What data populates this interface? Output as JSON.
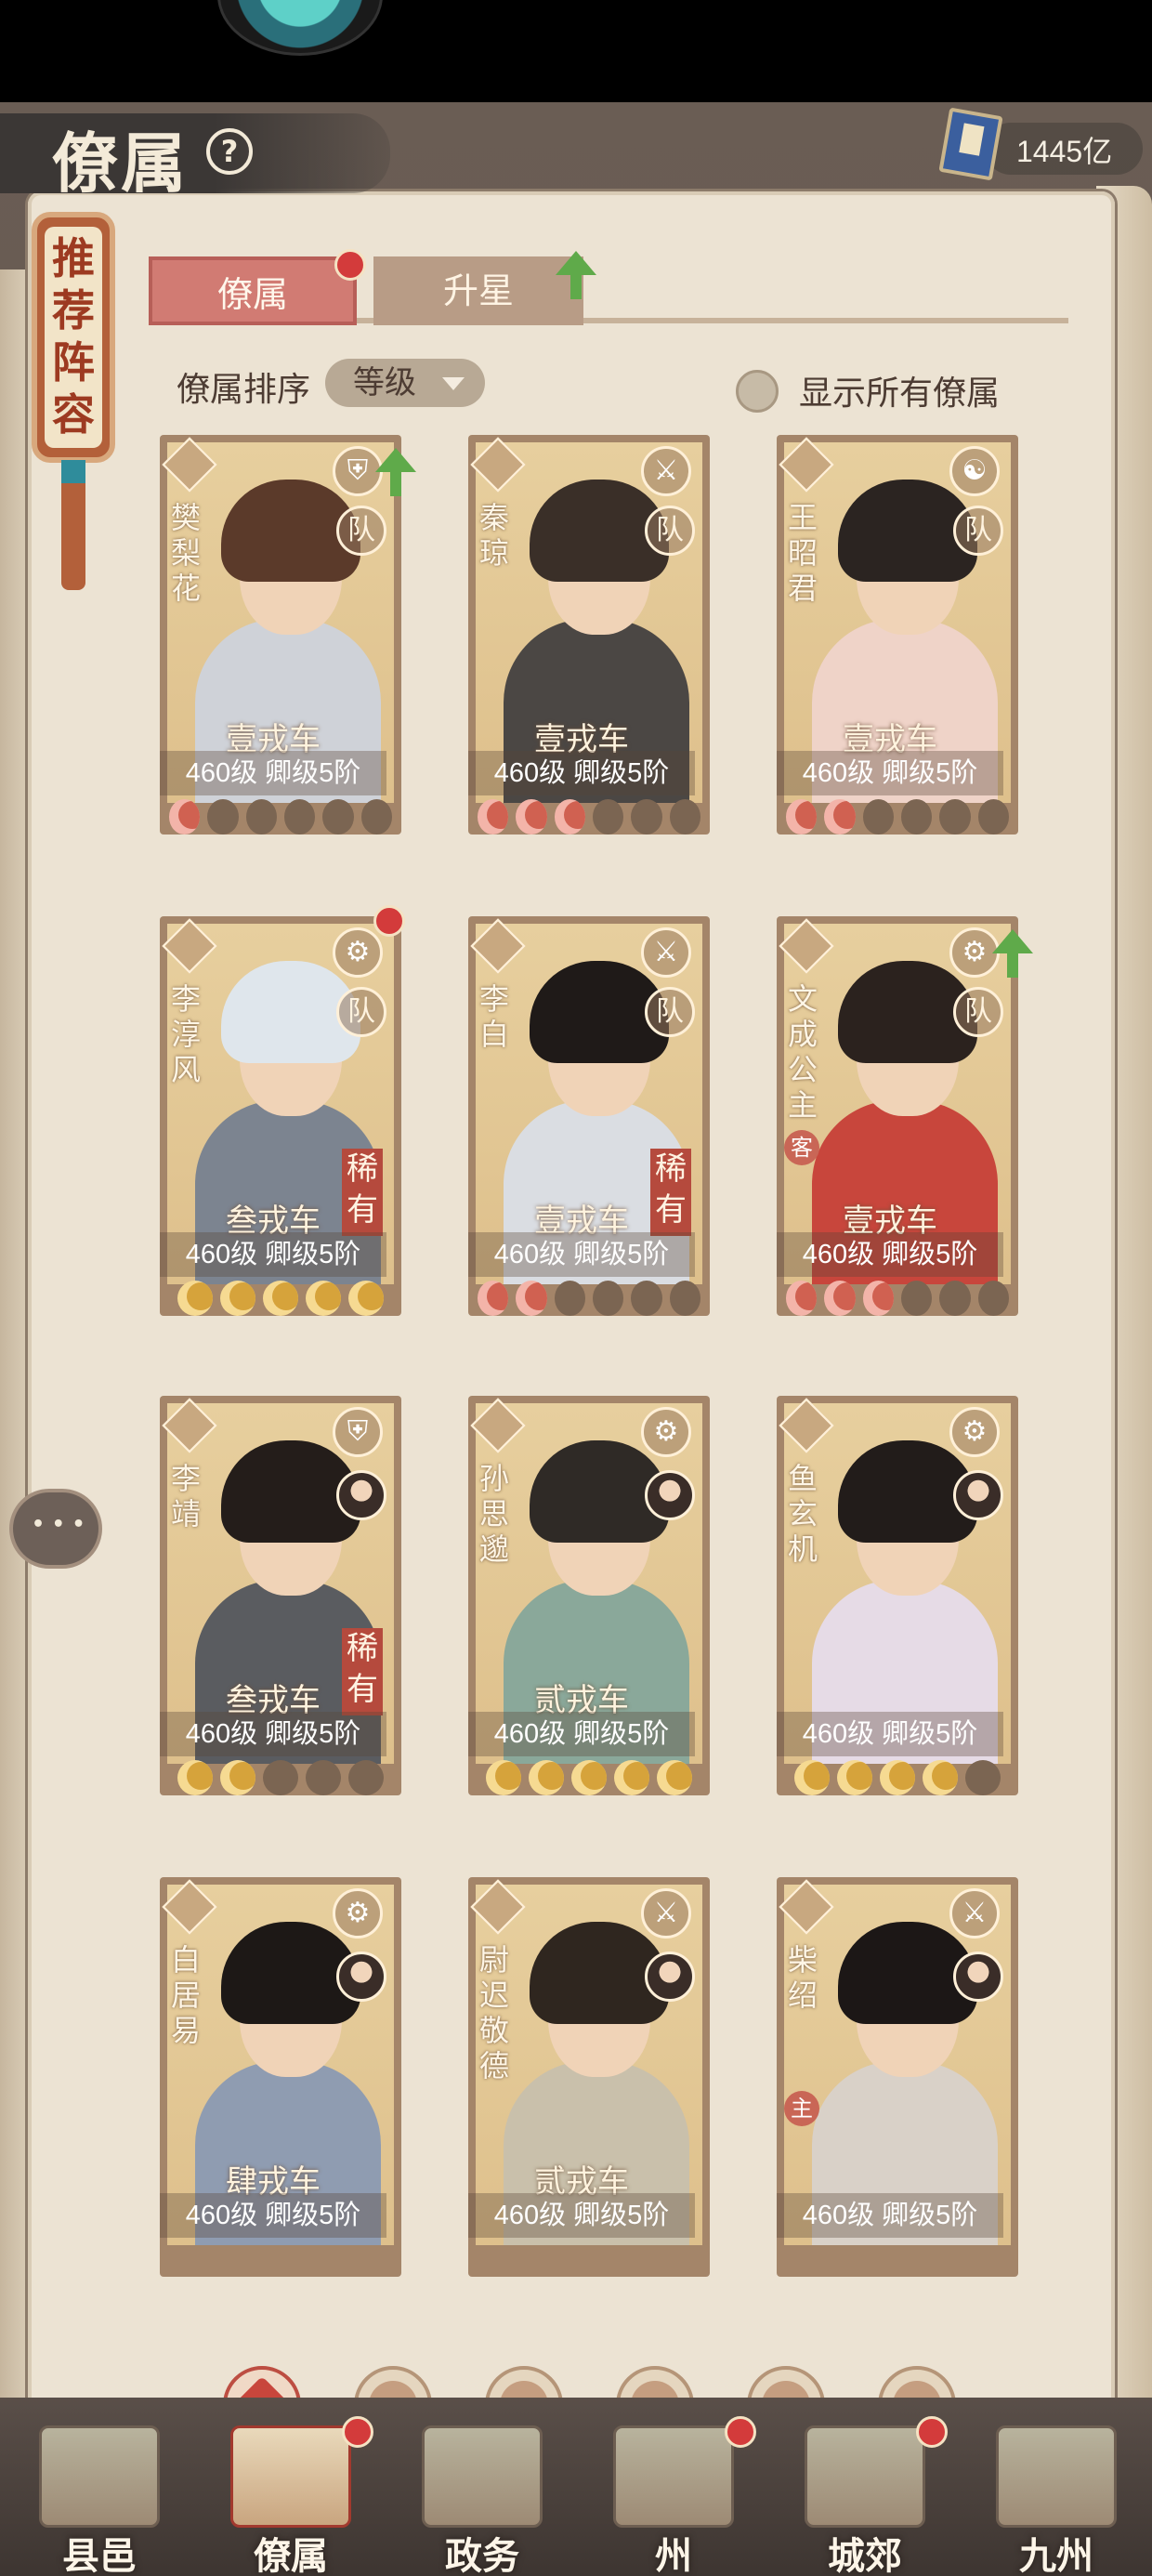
{
  "header": {
    "title": "僚属",
    "gold": "1445亿"
  },
  "recommend_scroll": "推荐阵容",
  "tabs": {
    "active": "僚属",
    "inactive": "升星"
  },
  "sort": {
    "label": "僚属排序",
    "value": "等级"
  },
  "show_all_label": "显示所有僚属",
  "colors": {
    "accent": "#d17b73",
    "paper": "#ece3d3",
    "frame": "#a48569",
    "rare": "#b54a3d"
  },
  "cards": [
    {
      "name": "樊梨花",
      "chariot": "壹戎车",
      "level": "460级",
      "rank": "卿级5阶",
      "team": "队",
      "class": "shield-icon",
      "stars": [
        "red",
        "empty",
        "empty",
        "empty",
        "empty",
        "empty"
      ],
      "hair": "#5b3a2a",
      "robe": "#cfd2d8",
      "upgrade": true
    },
    {
      "name": "秦琼",
      "chariot": "壹戎车",
      "level": "460级",
      "rank": "卿级5阶",
      "team": "队",
      "class": "sword-icon",
      "stars": [
        "red",
        "red",
        "red",
        "empty",
        "empty",
        "empty"
      ],
      "hair": "#3a2f28",
      "robe": "#4b4744"
    },
    {
      "name": "王昭君",
      "chariot": "壹戎车",
      "level": "460级",
      "rank": "卿级5阶",
      "team": "队",
      "class": "yinyang-icon",
      "stars": [
        "red",
        "red",
        "empty",
        "empty",
        "empty",
        "empty"
      ],
      "hair": "#2b2421",
      "robe": "#efd3c8"
    },
    {
      "name": "李淳风",
      "chariot": "叁戎车",
      "level": "460级",
      "rank": "卿级5阶",
      "team": "队",
      "class": "chariot-icon",
      "rare": "稀有",
      "stars": [
        "gold",
        "gold",
        "gold",
        "gold",
        "gold"
      ],
      "hair": "#dfe6ec",
      "robe": "#7c8490",
      "red_dot": true
    },
    {
      "name": "李白",
      "chariot": "壹戎车",
      "level": "460级",
      "rank": "卿级5阶",
      "team": "队",
      "class": "sword-icon",
      "rare": "稀有",
      "stars": [
        "red",
        "red",
        "empty",
        "empty",
        "empty",
        "empty"
      ],
      "hair": "#1f1a18",
      "robe": "#dadde2"
    },
    {
      "name": "文成公主",
      "tag": "客",
      "chariot": "壹戎车",
      "level": "460级",
      "rank": "卿级5阶",
      "team": "队",
      "class": "chariot-icon",
      "stars": [
        "red",
        "red",
        "red",
        "empty",
        "empty",
        "empty"
      ],
      "hair": "#2b221e",
      "robe": "#c8463c",
      "upgrade": true
    },
    {
      "name": "李靖",
      "chariot": "叁戎车",
      "level": "460级",
      "rank": "卿级5阶",
      "class": "shield-icon",
      "rare": "稀有",
      "avatar": true,
      "stars": [
        "gold",
        "gold",
        "empty",
        "empty",
        "empty"
      ],
      "hair": "#241d1a",
      "robe": "#5a5c60"
    },
    {
      "name": "孙思邈",
      "chariot": "贰戎车",
      "level": "460级",
      "rank": "卿级5阶",
      "class": "chariot-icon",
      "avatar": true,
      "stars": [
        "gold",
        "gold",
        "gold",
        "gold",
        "gold"
      ],
      "hair": "#2f2a26",
      "robe": "#8aa89a"
    },
    {
      "name": "鱼玄机",
      "chariot": "",
      "level": "460级",
      "rank": "卿级5阶",
      "class": "chariot-icon",
      "avatar": true,
      "stars": [
        "gold",
        "gold",
        "gold",
        "gold",
        "empty"
      ],
      "hair": "#221c1a",
      "robe": "#e6dbe6"
    },
    {
      "name": "白居易",
      "chariot": "肆戎车",
      "level": "460级",
      "rank": "卿级5阶",
      "class": "chariot-icon",
      "avatar": true,
      "stars": [],
      "hair": "#1d1816",
      "robe": "#8f9cb1"
    },
    {
      "name": "尉迟敬德",
      "chariot": "贰戎车",
      "level": "460级",
      "rank": "卿级5阶",
      "class": "sword-icon",
      "avatar": true,
      "stars": [],
      "hair": "#2f261f",
      "robe": "#c9c0ab"
    },
    {
      "name": "柴绍",
      "tag": "主",
      "chariot": "",
      "level": "460级",
      "rank": "卿级5阶",
      "class": "sword-icon",
      "avatar": true,
      "stars": [],
      "hair": "#1c1716",
      "robe": "#d9d1c8"
    }
  ],
  "filters": [
    "all-icon",
    "faction-1-icon",
    "faction-2-icon",
    "faction-3-icon",
    "faction-4-icon",
    "faction-5-icon"
  ],
  "nav": [
    {
      "label": "县邑",
      "dot": false
    },
    {
      "label": "僚属",
      "dot": true,
      "active": true
    },
    {
      "label": "政务",
      "dot": false
    },
    {
      "label": "州",
      "dot": true
    },
    {
      "label": "城郊",
      "dot": true
    },
    {
      "label": "九州",
      "dot": false
    }
  ]
}
